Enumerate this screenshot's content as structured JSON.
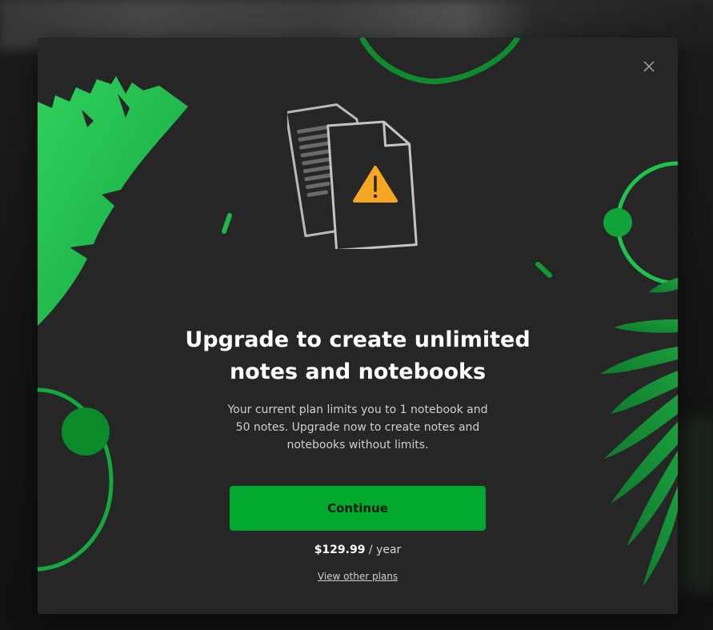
{
  "dialog": {
    "title": "Upgrade to create unlimited notes and notebooks",
    "description": "Your current plan limits you to 1 notebook and 50 notes. Upgrade now to create notes and notebooks without limits.",
    "continue_label": "Continue",
    "price_amount": "$129.99",
    "price_period": " / year",
    "other_plans_label": "View other plans",
    "close_icon": "close-icon",
    "hero_icon": "documents-warning-icon"
  },
  "colors": {
    "modal_background": "#262626",
    "accent_green": "#00a82d",
    "leaf_green": "#1db954",
    "warning_orange": "#f5a623"
  }
}
